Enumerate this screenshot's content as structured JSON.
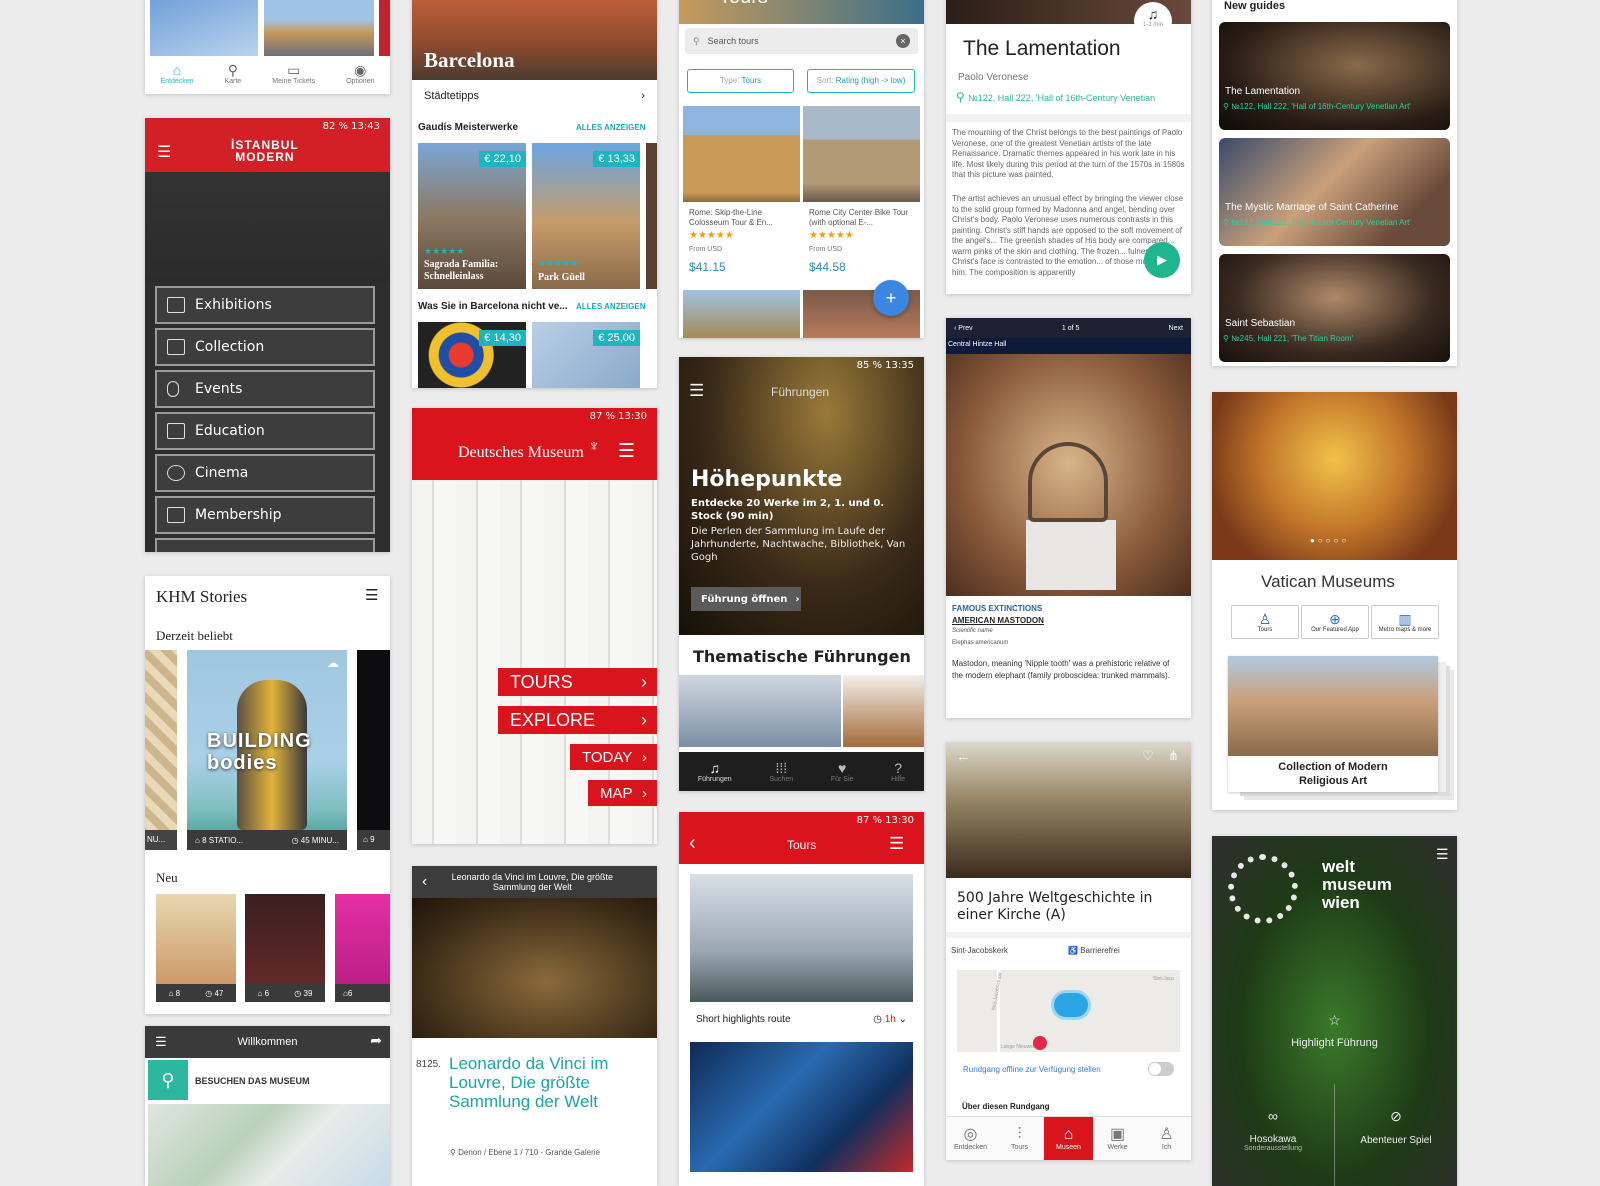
{
  "col1_top": {
    "nav": [
      {
        "label": "Entdecken",
        "icon": "map-outline-icon"
      },
      {
        "label": "Karte",
        "icon": "location-pin-icon"
      },
      {
        "label": "Meine Tickets",
        "icon": "ticket-icon"
      },
      {
        "label": "Optionen",
        "icon": "user-circle-icon"
      }
    ]
  },
  "istanbul": {
    "status": "82 %  13:43",
    "logo_line1": "İSTANBUL",
    "logo_line2": "MODERN",
    "menu": [
      "Exhibitions",
      "Collection",
      "Events",
      "Education",
      "Cinema",
      "Membership"
    ],
    "accent": "#d31f26"
  },
  "khm": {
    "title": "KHM Stories",
    "section1": "Derzeit beliebt",
    "card_text": "BUILDING bodies",
    "meta_left": "8 STATIO...",
    "meta_right": "45 MINU...",
    "meta_prev": "NU...",
    "meta_next": "9",
    "section2": "Neu",
    "new_items": [
      {
        "a": "8",
        "b": "47"
      },
      {
        "a": "6",
        "b": "39"
      },
      {
        "a": "6",
        "b": ""
      }
    ]
  },
  "willkommen": {
    "title": "Willkommen",
    "visit": "BESUCHEN DAS MUSEUM"
  },
  "barcelona": {
    "city": "Barcelona",
    "tips": "Städtetipps",
    "section1": "Gaudís Meisterwerke",
    "show_all": "ALLES ANZEIGEN",
    "cards": [
      {
        "price": "€ 22,10",
        "name": "Sagrada Familia: Schnelleinlass"
      },
      {
        "price": "€ 13,33",
        "name": "Park Güell"
      }
    ],
    "section2": "Was Sie in Barcelona nicht ve...",
    "prices2": [
      "€ 14,30",
      "€ 25,00"
    ]
  },
  "deutsches": {
    "status": "87 %  13:30",
    "brand": "Deutsches Museum",
    "buttons": [
      "TOURS",
      "EXPLORE",
      "TODAY",
      "MAP"
    ]
  },
  "leonardo": {
    "header": "Leonardo da Vinci im Louvre, Die größte Sammlung der Welt",
    "number": "8125.",
    "title": "Leonardo da Vinci im Louvre, Die größte Sammlung der Welt",
    "location": "Denon / Ebene 1 / 710 - Grande Galerie"
  },
  "tours_search": {
    "header_fragment": "Tours",
    "search_placeholder": "Search tours",
    "type_label": "Type:",
    "type_value": "Tours",
    "sort_label": "Sort:",
    "sort_value": "Rating (high -> low)",
    "items": [
      {
        "title": "Rome: Skip-the-Line Colosseum Tour & En...",
        "from": "From USD",
        "price": "$41.15",
        "stars": "★★★★★"
      },
      {
        "title": "Rome City Center Bike Tour (with optional E-...",
        "from": "From USD",
        "price": "$44.58",
        "stars": "★★★★★"
      }
    ],
    "fab": "+"
  },
  "fuehrungen": {
    "status": "85 %  13:35",
    "title": "Führungen",
    "headline": "Höhepunkte",
    "sub1": "Entdecke 20 Werke im 2, 1. und 0. Stock (90 min)",
    "sub2": "Die Perlen der Sammlung im Laufe der Jahrhunderte, Nachtwache, Bibliothek, Van Gogh",
    "button": "Führung öffnen",
    "section": "Thematische Führungen",
    "nav": [
      {
        "label": "Führungen",
        "icon": "headphones-icon"
      },
      {
        "label": "Suchen",
        "icon": "grid-icon"
      },
      {
        "label": "Für Sie",
        "icon": "heart-icon"
      },
      {
        "label": "Hilfe",
        "icon": "question-icon"
      }
    ]
  },
  "tours_red": {
    "status": "87 %  13:30",
    "title": "Tours",
    "route": "Short highlights route",
    "duration": "1h"
  },
  "lamentation": {
    "duration": "1-2 min",
    "title": "The Lamentation",
    "artist": "Paolo Veronese",
    "location": "№122, Hall  222, 'Hall of 16th-Century Venetian",
    "para1": "The mourning of the Christ belongs to the best paintings of Paolo Veronese, one of the greatest Venetian artists of the late Renaissance. Dramatic themes appeared in his work late in his life. Most likely during this period at the turn of the 1570s in 1580s that this picture was painted.",
    "para2": "The artist achieves an unusual effect by bringing the viewer close to the solid group formed by Madonna and angel, bending over Christ's body. Paolo Veronese uses numerous contrasts in this painting. Christ's stiff hands are opposed to the soft movement of the angel's... The greenish shades of His body are compared... warm pinks of the skin and clothing. The frozen... fulness of Christ's face is contrasted to the emotion... of those mourning him. The composition is apparently"
  },
  "mastodon": {
    "prev": "Prev",
    "counter": "1 of 5",
    "next": "Next",
    "hall": "Central Hintze Hall",
    "category": "FAMOUS EXTINCTIONS",
    "name": "AMERICAN MASTODON",
    "sci_label": "Scientific name",
    "sci_name": "Elephas americanum",
    "desc": "Mastodon, meaning 'Nipple tooth' was a prehistoric relative of the modern elephant (family proboscidea: trunked mammals)."
  },
  "kirche": {
    "title": "500 Jahre Weltgeschichte in einer Kirche (A)",
    "place": "Sint-Jacobskerk",
    "access": "Barrierefrei",
    "offline": "Rundgang offline zur Verfügung stellen",
    "about": "Über diesen Rundgang",
    "street1": "Sint-Jacobsstraat",
    "street2": "Lange Nieuwstraat",
    "street3": "Sint-Jaco",
    "nav": [
      {
        "label": "Entdecken",
        "icon": "compass-icon"
      },
      {
        "label": "Tours",
        "icon": "tours-icon"
      },
      {
        "label": "Museen",
        "icon": "museum-icon"
      },
      {
        "label": "Werke",
        "icon": "frame-icon"
      },
      {
        "label": "Ich",
        "icon": "person-icon"
      }
    ]
  },
  "new_guides": {
    "heading": "New guides",
    "items": [
      {
        "title": "The Lamentation",
        "loc": "№122, Hall  222, 'Hall of 16th-Century Venetian Art'"
      },
      {
        "title": "The Mystic Marriage of Saint Catherine",
        "loc": "№167, Hall  222, 'Hall of 16th-Century Venetian Art'"
      },
      {
        "title": "Saint Sebastian",
        "loc": "№245, Hall  221, 'The Titian Room'"
      }
    ]
  },
  "vatican": {
    "title": "Vatican Museums",
    "buttons": [
      "Tours",
      "Our Featured App",
      "Metro maps & more"
    ],
    "collection": "Collection of Modern Religious Art"
  },
  "weltmuseum": {
    "brand": [
      "welt",
      "museum",
      "wien"
    ],
    "highlight": "Highlight Führung",
    "left_title": "Hosokawa",
    "left_sub": "Sonderausstellung",
    "right_title": "Abenteuer Spiel"
  }
}
